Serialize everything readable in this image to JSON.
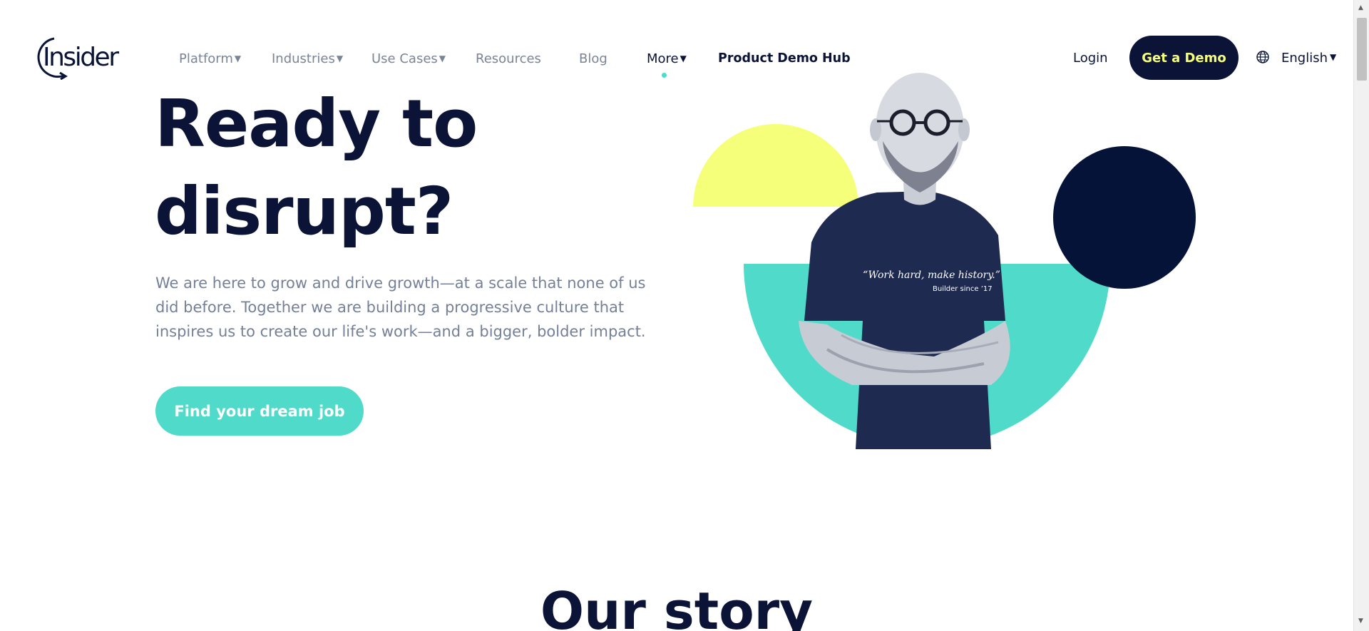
{
  "header": {
    "logo_text": "Insider",
    "nav": [
      {
        "label": "Platform",
        "has_caret": true
      },
      {
        "label": "Industries",
        "has_caret": true
      },
      {
        "label": "Use Cases",
        "has_caret": true
      },
      {
        "label": "Resources",
        "has_caret": false
      },
      {
        "label": "Blog",
        "has_caret": false
      },
      {
        "label": "More",
        "has_caret": true,
        "active": true
      },
      {
        "label": "Product Demo Hub",
        "has_caret": false
      }
    ],
    "caret_glyph": "▼",
    "login_label": "Login",
    "demo_label": "Get a Demo",
    "language_label": "English"
  },
  "hero": {
    "title_line1": "Ready to",
    "title_line2": "disrupt?",
    "body_line1": "We are here to grow and drive growth—at a scale that none of us",
    "body_line2": "did before. Together we are building a progressive culture that",
    "body_line3": "inspires us to create our life's work—and a bigger, bolder impact.",
    "cta_label": "Find your dream job",
    "shirt_quote": "“Work hard, make history.”",
    "shirt_sub": "Builder since ’17"
  },
  "story": {
    "title": "Our story"
  },
  "colors": {
    "navy": "#0b1437",
    "teal": "#4fdac9",
    "yellow": "#f6ff79",
    "gray_text": "#74809a"
  },
  "icons": {
    "globe": "globe-icon",
    "caret": "caret-down-icon"
  }
}
